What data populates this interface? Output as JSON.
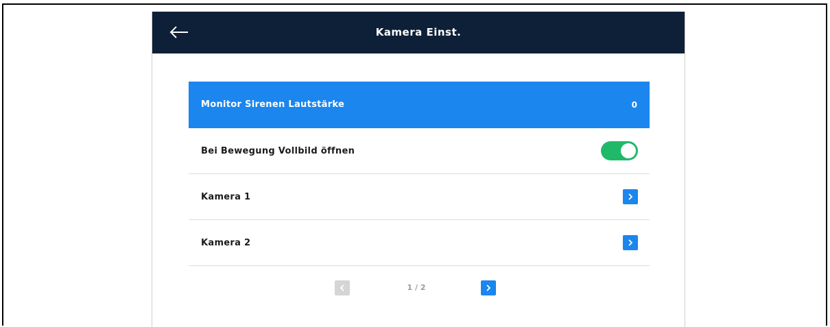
{
  "header": {
    "title": "Kamera Einst.",
    "back_icon": "arrow-left-icon"
  },
  "settings": [
    {
      "label": "Monitor Sirenen Lautstärke",
      "value": "0",
      "selected": true
    },
    {
      "label": "Bei Bewegung Vollbild öffnen",
      "toggle": true
    },
    {
      "label": "Kamera 1",
      "action_icon": "chevron-right-icon"
    },
    {
      "label": "Kamera 2",
      "action_icon": "chevron-right-icon"
    }
  ],
  "pagination": {
    "indicator": "1 / 2",
    "current_page": 1,
    "total_pages": 2,
    "prev_enabled": false,
    "next_enabled": true
  },
  "colors": {
    "header_bg": "#0e1f38",
    "accent": "#1a86ee",
    "toggle_on": "#1fb969",
    "disabled": "#d5d5d5"
  }
}
